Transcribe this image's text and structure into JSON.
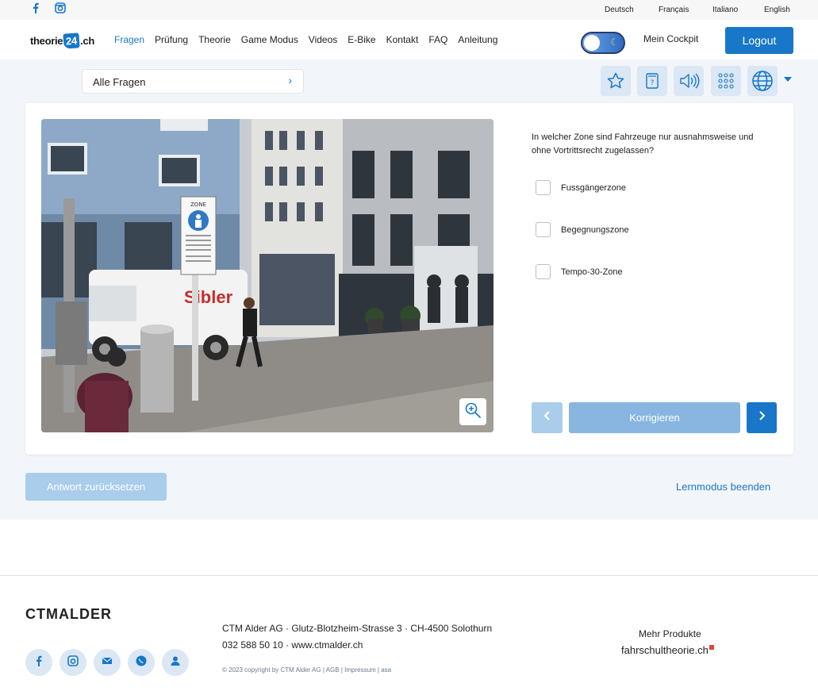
{
  "topbar": {
    "languages": [
      "Deutsch",
      "Français",
      "Italiano",
      "English"
    ]
  },
  "header": {
    "logo_pre": "theorie",
    "logo_badge": "24",
    "logo_post": ".ch",
    "nav": [
      "Fragen",
      "Prüfung",
      "Theorie",
      "Game Modus",
      "Videos",
      "E-Bike",
      "Kontakt",
      "FAQ",
      "Anleitung"
    ],
    "active_nav": "Fragen",
    "cockpit": "Mein Cockpit",
    "logout": "Logout"
  },
  "filter": {
    "label": "Alle Fragen"
  },
  "toolbar_icons": [
    "star-icon",
    "help-card-icon",
    "speaker-icon",
    "grid-icon",
    "globe-icon"
  ],
  "question": {
    "text": "In welcher Zone sind Fahrzeuge nur ausnahmsweise und ohne Vortrittsrecht zugelassen?",
    "answers": [
      "Fussgängerzone",
      "Begegnungszone",
      "Tempo-30-Zone"
    ]
  },
  "photo": {
    "sign_text": "ZONE",
    "van_text": "Sibler"
  },
  "actions": {
    "correct": "Korrigieren",
    "reset": "Antwort zurücksetzen",
    "quit": "Lernmodus beenden"
  },
  "footer": {
    "logo": "CTMALDER",
    "address": "CTM Alder AG · Glutz-Blotzheim-Strasse 3 · CH-4500 Solothurn",
    "phone": "032 588 50 10 · www.ctmalder.ch",
    "copyright": "© 2023 copyright by CTM Alder AG | AGB | Impressum | asa",
    "more_products": "Mehr Produkte",
    "product": "fahrschultheorie.ch"
  },
  "colors": {
    "accent": "#1877c8",
    "accent_light": "#a9cdeb",
    "background": "#f2f5fa"
  }
}
